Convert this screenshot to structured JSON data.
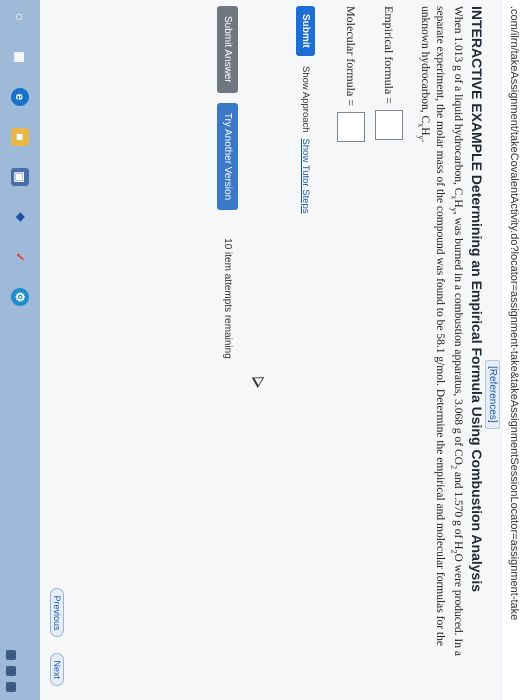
{
  "browser": {
    "url": ".com/ilrn/takeAssignment/takeCovalentActivity.do?locator=assignment-take&takeAssignmentSessionLocator=assignment-take"
  },
  "page": {
    "references_label": "[References]",
    "title_tag": "INTERACTIVE EXAMPLE",
    "title_text": "Determining an Empirical Formula Using Combustion Analysis",
    "problem_part1": "When 1.013 g of a liquid hydrocarbon, C",
    "problem_part2": "H",
    "problem_part3": ", was burned in a combustion apparatus, 3.068 g of CO",
    "problem_part4": " and 1.570 g of H",
    "problem_part5": "O were produced. In a separate experiment, the molar mass of the compound was found to be 58.1 g/mol. Determine the empirical and molecular formulas for the unknown hydrocarbon, C",
    "problem_part6": "H",
    "problem_part7": ".",
    "sub_x": "x",
    "sub_y": "y",
    "sub_2": "2",
    "empirical_label": "Empirical formula =",
    "molecular_label": "Molecular formula =",
    "submit_label": "Submit",
    "show_approach_label": "Show Approach",
    "show_tutor_steps_label": "Show Tutor Steps",
    "submit_answer_label": "Submit Answer",
    "try_another_label": "Try Another Version",
    "attempts_text": "10 item attempts remaining",
    "previous_label": "Previous",
    "next_label": "Next"
  },
  "colors": {
    "primary_button": "#1d6ed4",
    "link": "#1c5aa6",
    "taskbar": "#9fb9d8"
  },
  "taskbar": {
    "icons": [
      "windows-search-icon",
      "task-view-icon",
      "edge-icon",
      "files-icon",
      "store-icon",
      "dropbox-icon",
      "apps-icon",
      "settings-icon"
    ]
  }
}
